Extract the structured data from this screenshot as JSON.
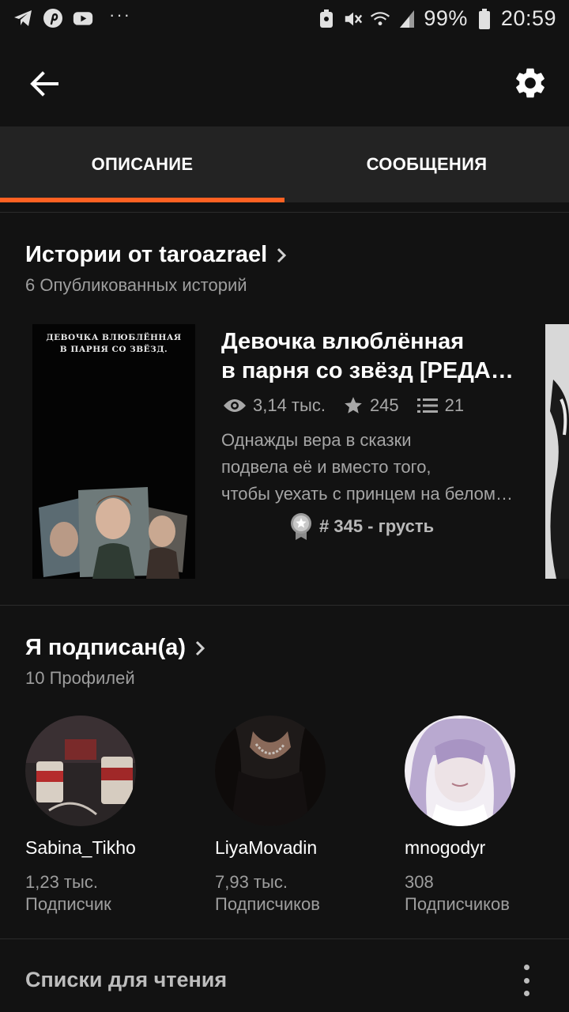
{
  "status_bar": {
    "left_icons": [
      "telegram-icon",
      "pinterest-icon",
      "youtube-icon",
      "more-dots-icon"
    ],
    "right_icons": [
      "notification-icon",
      "mute-icon",
      "wifi-icon",
      "signal-icon",
      "battery-icon"
    ],
    "battery": "99%",
    "time": "20:59"
  },
  "toolbar": {
    "back_icon": "arrow-left-icon",
    "settings_icon": "gear-icon"
  },
  "tabs": [
    {
      "label": "ОПИСАНИЕ",
      "active": true
    },
    {
      "label": "СООБЩЕНИЯ",
      "active": false
    }
  ],
  "stories_section": {
    "title": "Истории от taroazrael",
    "subtitle": "6 Опубликованных историй",
    "story": {
      "cover_text_line1": "ДЕВОЧКА ВЛЮБЛЁННАЯ",
      "cover_text_line2": "В ПАРНЯ СО ЗВЁЗД.",
      "title_line1": "Девочка влюблённая",
      "title_line2": "в парня со звёзд [РЕДАКТИРУЕТСЯ]",
      "reads": "3,14 тыс.",
      "votes": "245",
      "parts": "21",
      "description_line1": "Однажды вера в сказки",
      "description_line2": "подвела её и вместо того,",
      "description_line3": "чтобы уехать с принцем на белом коне",
      "rank": "# 345 - грусть"
    }
  },
  "following_section": {
    "title": "Я подписан(а)",
    "subtitle": "10 Профилей",
    "profiles": [
      {
        "name": "Sabina_Tikho",
        "count": "1,23 тыс.",
        "label": "Подписчик"
      },
      {
        "name": "LiyaMovadin",
        "count": "7,93 тыс.",
        "label": "Подписчиков"
      },
      {
        "name": "mnogodyr",
        "count": "308",
        "label": "Подписчиков"
      }
    ]
  },
  "reading_lists": {
    "title": "Списки для чтения"
  },
  "colors": {
    "accent": "#ff6122",
    "background": "#121212",
    "tabbar": "#232323"
  }
}
